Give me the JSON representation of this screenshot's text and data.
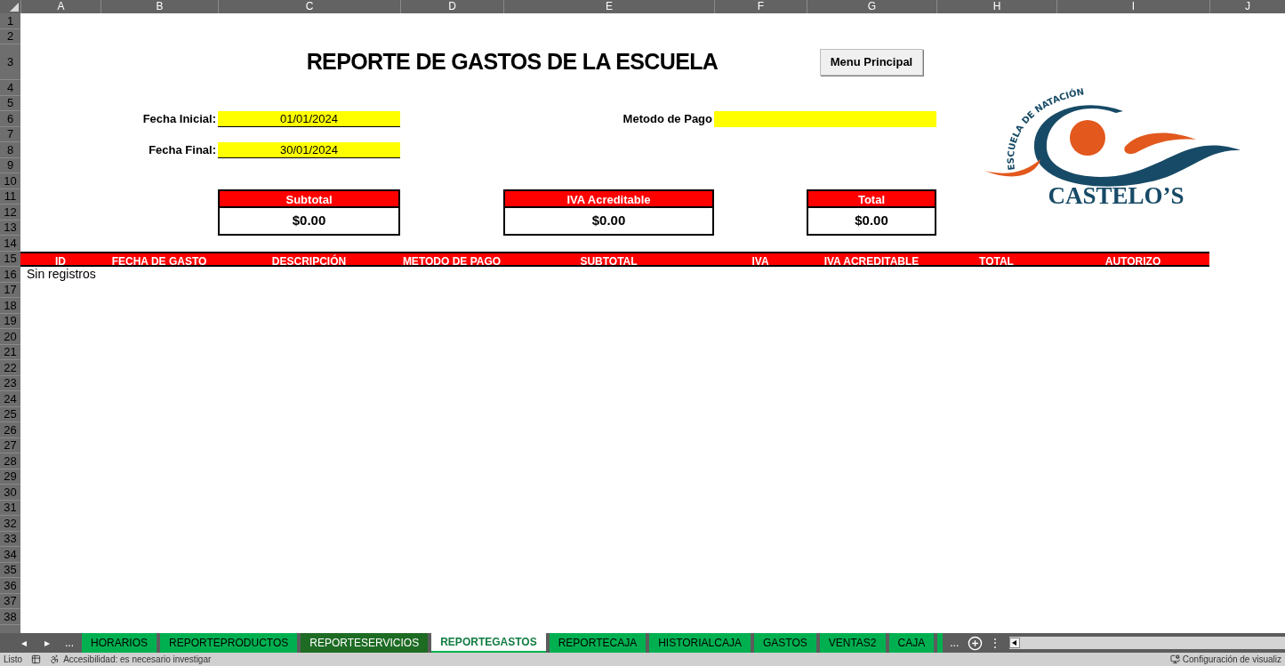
{
  "column_headers": [
    "A",
    "B",
    "C",
    "D",
    "E",
    "F",
    "G",
    "H",
    "I",
    "J"
  ],
  "row_numbers": [
    "1",
    "2",
    "3",
    "4",
    "5",
    "6",
    "7",
    "8",
    "9",
    "10",
    "11",
    "12",
    "13",
    "14",
    "15",
    "16",
    "17",
    "18",
    "19",
    "20",
    "21",
    "22",
    "23",
    "24",
    "25",
    "26",
    "27",
    "28",
    "29",
    "30",
    "31",
    "32",
    "33",
    "34",
    "35",
    "36",
    "37",
    "38"
  ],
  "title": "REPORTE DE GASTOS DE LA ESCUELA",
  "menu_button": "Menu Principal",
  "filters": [
    {
      "label": "Fecha Inicial:",
      "value": "01/01/2024"
    },
    {
      "label": "Fecha Final:",
      "value": "30/01/2024"
    },
    {
      "label": "Metodo de Pago"
    }
  ],
  "summary": [
    {
      "label": "Subtotal",
      "value": "$0.00"
    },
    {
      "label": "IVA Acreditable",
      "value": "$0.00"
    },
    {
      "label": "Total",
      "value": "$0.00"
    }
  ],
  "logo": {
    "tagline": "ESCUELA DE NATACIÓN",
    "name": "CASTELO’S"
  },
  "table": {
    "columns": [
      "ID",
      "FECHA DE GASTO",
      "DESCRIPCIÓN",
      "METODO DE PAGO",
      "SUBTOTAL",
      "IVA",
      "IVA ACREDITABLE",
      "TOTAL",
      "AUTORIZO"
    ],
    "empty_message": "Sin registros"
  },
  "sheet_nav": {
    "prev": "◂",
    "next": "▸",
    "more_left": "...",
    "more_right": "...",
    "options": "⋮"
  },
  "tabs": [
    {
      "label": "HORARIOS",
      "selected": false,
      "color": "#00b050"
    },
    {
      "label": "REPORTEPRODUCTOS",
      "selected": false,
      "color": "#00b050"
    },
    {
      "label": "REPORTESERVICIOS",
      "selected": false,
      "color": "#1e6b24"
    },
    {
      "label": "REPORTEGASTOS",
      "selected": true,
      "color": "#00b050"
    },
    {
      "label": "REPORTECAJA",
      "selected": false,
      "color": "#00b050"
    },
    {
      "label": "HISTORIALCAJA",
      "selected": false,
      "color": "#00b050"
    },
    {
      "label": "GASTOS",
      "selected": false,
      "color": "#00b050"
    },
    {
      "label": "VENTAS2",
      "selected": false,
      "color": "#00b050"
    },
    {
      "label": "CAJA",
      "selected": false,
      "color": "#00b050"
    }
  ],
  "overflow_tab": {
    "color": "#00b050"
  },
  "status_bar": {
    "mode": "Listo",
    "accessibility": "Accesibilidad: es necesario investigar",
    "display_settings": "Configuración de visualiz"
  }
}
